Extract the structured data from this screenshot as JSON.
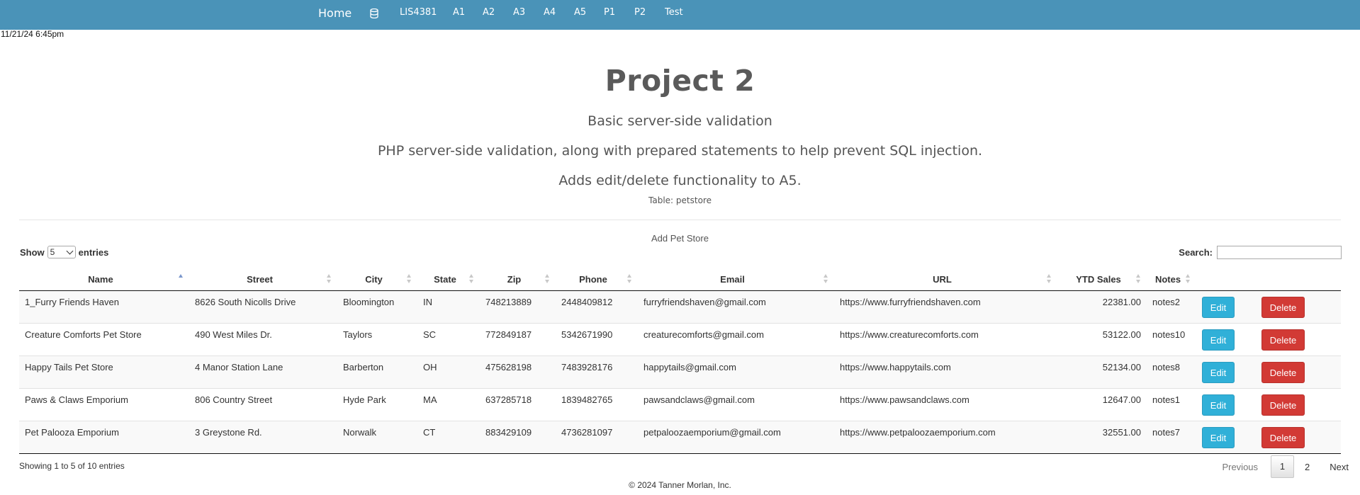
{
  "nav": {
    "brand": "Home",
    "db_icon": "database-icon",
    "items": [
      "LIS4381",
      "A1",
      "A2",
      "A3",
      "A4",
      "A5",
      "P1",
      "P2",
      "Test"
    ]
  },
  "timestamp": "11/21/24 6:45pm",
  "header": {
    "title": "Project 2",
    "line1": "Basic server-side validation",
    "line2": "PHP server-side validation, along with prepared statements to help prevent SQL injection.",
    "line3": "Adds edit/delete functionality to A5.",
    "table_caption": "Table: petstore"
  },
  "add_link": "Add Pet Store",
  "length": {
    "prefix": "Show",
    "value": "5",
    "suffix": "entries"
  },
  "search": {
    "label": "Search:",
    "value": ""
  },
  "table": {
    "columns": [
      "Name",
      "Street",
      "City",
      "State",
      "Zip",
      "Phone",
      "Email",
      "URL",
      "YTD Sales",
      "Notes"
    ],
    "sorted_column": "Name",
    "rows": [
      {
        "name": "1_Furry Friends Haven",
        "street": "8626 South Nicolls Drive",
        "city": "Bloomington",
        "state": "IN",
        "zip": "748213889",
        "phone": "2448409812",
        "email": "furryfriendshaven@gmail.com",
        "url": "https://www.furryfriendshaven.com",
        "sales": "22381.00",
        "notes": "notes2"
      },
      {
        "name": "Creature Comforts Pet Store",
        "street": "490 West Miles Dr.",
        "city": "Taylors",
        "state": "SC",
        "zip": "772849187",
        "phone": "5342671990",
        "email": "creaturecomforts@gmail.com",
        "url": "https://www.creaturecomforts.com",
        "sales": "53122.00",
        "notes": "notes10"
      },
      {
        "name": "Happy Tails Pet Store",
        "street": "4 Manor Station Lane",
        "city": "Barberton",
        "state": "OH",
        "zip": "475628198",
        "phone": "7483928176",
        "email": "happytails@gmail.com",
        "url": "https://www.happytails.com",
        "sales": "52134.00",
        "notes": "notes8"
      },
      {
        "name": "Paws & Claws Emporium",
        "street": "806 Country Street",
        "city": "Hyde Park",
        "state": "MA",
        "zip": "637285718",
        "phone": "1839482765",
        "email": "pawsandclaws@gmail.com",
        "url": "https://www.pawsandclaws.com",
        "sales": "12647.00",
        "notes": "notes1"
      },
      {
        "name": "Pet Palooza Emporium",
        "street": "3 Greystone Rd.",
        "city": "Norwalk",
        "state": "CT",
        "zip": "883429109",
        "phone": "4736281097",
        "email": "petpaloozaemporium@gmail.com",
        "url": "https://www.petpaloozaemporium.com",
        "sales": "32551.00",
        "notes": "notes7"
      }
    ],
    "edit_label": "Edit",
    "delete_label": "Delete"
  },
  "info": "Showing 1 to 5 of 10 entries",
  "pagination": {
    "previous": "Previous",
    "current": "1",
    "page2": "2",
    "next": "Next"
  },
  "footer": "© 2024 Tanner Morlan, Inc.",
  "colors": {
    "navbar": "#4a93b8",
    "edit_button": "#30b0d8",
    "delete_button": "#d23a35"
  }
}
